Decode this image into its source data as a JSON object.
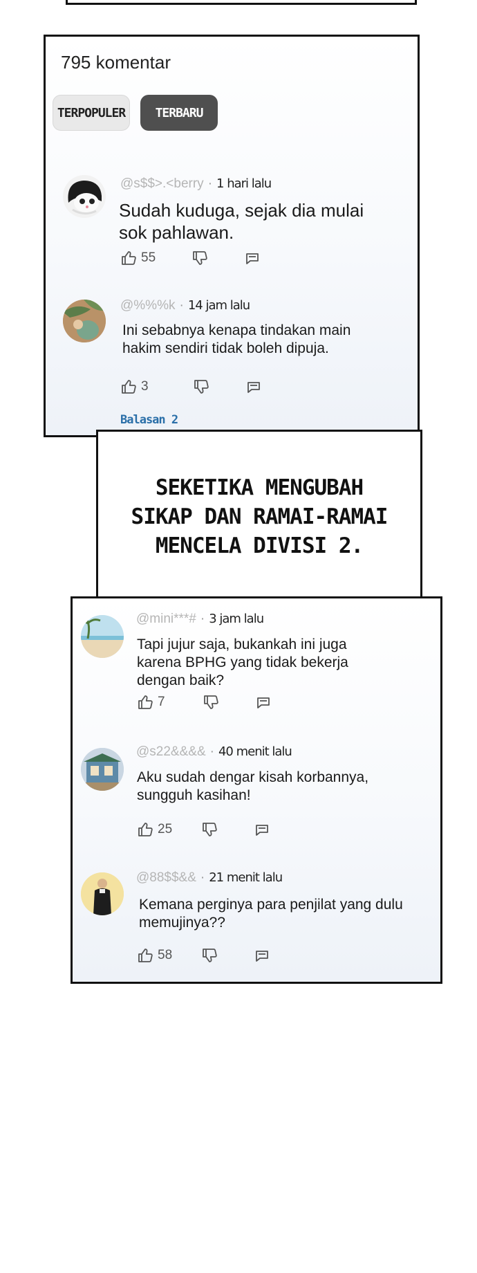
{
  "comments_header": {
    "count_label": "795 komentar"
  },
  "sort": {
    "popular_label": "TERPOPULER",
    "newest_label": "TERBARU"
  },
  "comments": [
    {
      "user": "@s$$>.<berry",
      "time": "1 hari lalu",
      "text": "Sudah kuduga, sejak dia mulai sok pahlawan.",
      "likes": "55"
    },
    {
      "user": "@%%%k",
      "time": "14 jam lalu",
      "text": "Ini sebabnya kenapa tindakan main hakim sendiri tidak boleh dipuja.",
      "likes": "3",
      "replies_label": "Balasan 2"
    },
    {
      "user": "@mini***#",
      "time": "3 jam lalu",
      "text": "Tapi jujur saja, bukankah ini juga karena BPHG yang tidak bekerja dengan baik?",
      "likes": "7"
    },
    {
      "user": "@s22&&&&",
      "time": "40 menit lalu",
      "text": "Aku sudah dengar kisah korbannya, sungguh kasihan!",
      "likes": "25"
    },
    {
      "user": "@88$$&&",
      "time": "21 menit lalu",
      "text": "Kemana perginya para penjilat yang dulu memujinya??",
      "likes": "58"
    }
  ],
  "caption": {
    "text": "SEKETIKA MENGUBAH SIKAP DAN RAMAI-RAMAI MENCELA DIVISI 2."
  },
  "separator": "·",
  "icons": {
    "like": "thumbs-up-icon",
    "dislike": "thumbs-down-icon",
    "reply": "reply-icon"
  },
  "colors": {
    "sort_active_bg": "#4f4f4f",
    "sort_inactive_bg": "#e9e9e9",
    "reply_link": "#2a6fa8"
  }
}
